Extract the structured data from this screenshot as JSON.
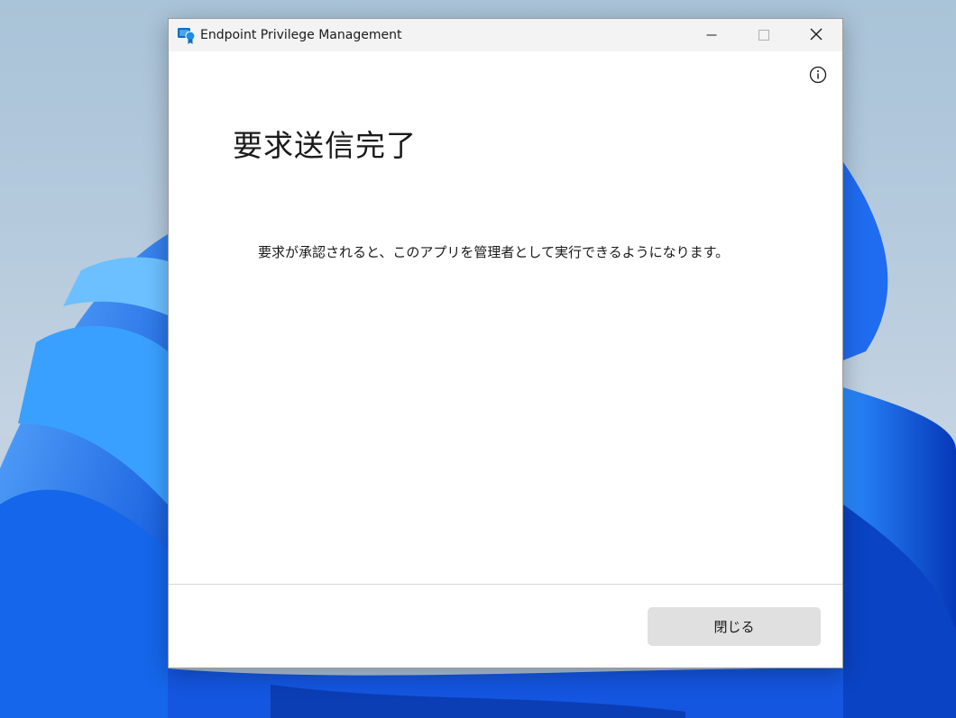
{
  "window": {
    "title": "Endpoint Privilege Management",
    "app_icon": "endpoint-privilege-management-icon",
    "controls": {
      "minimize": "minimize-icon",
      "maximize": "maximize-icon",
      "close": "close-icon"
    }
  },
  "dialog": {
    "info_icon": "info-icon",
    "heading": "要求送信完了",
    "message": "要求が承認されると、このアプリを管理者として実行できるようになります。",
    "close_button_label": "閉じる"
  },
  "colors": {
    "titlebar": "#f3f3f3",
    "button": "#e0e0e0",
    "accent": "#0f6cbd"
  }
}
